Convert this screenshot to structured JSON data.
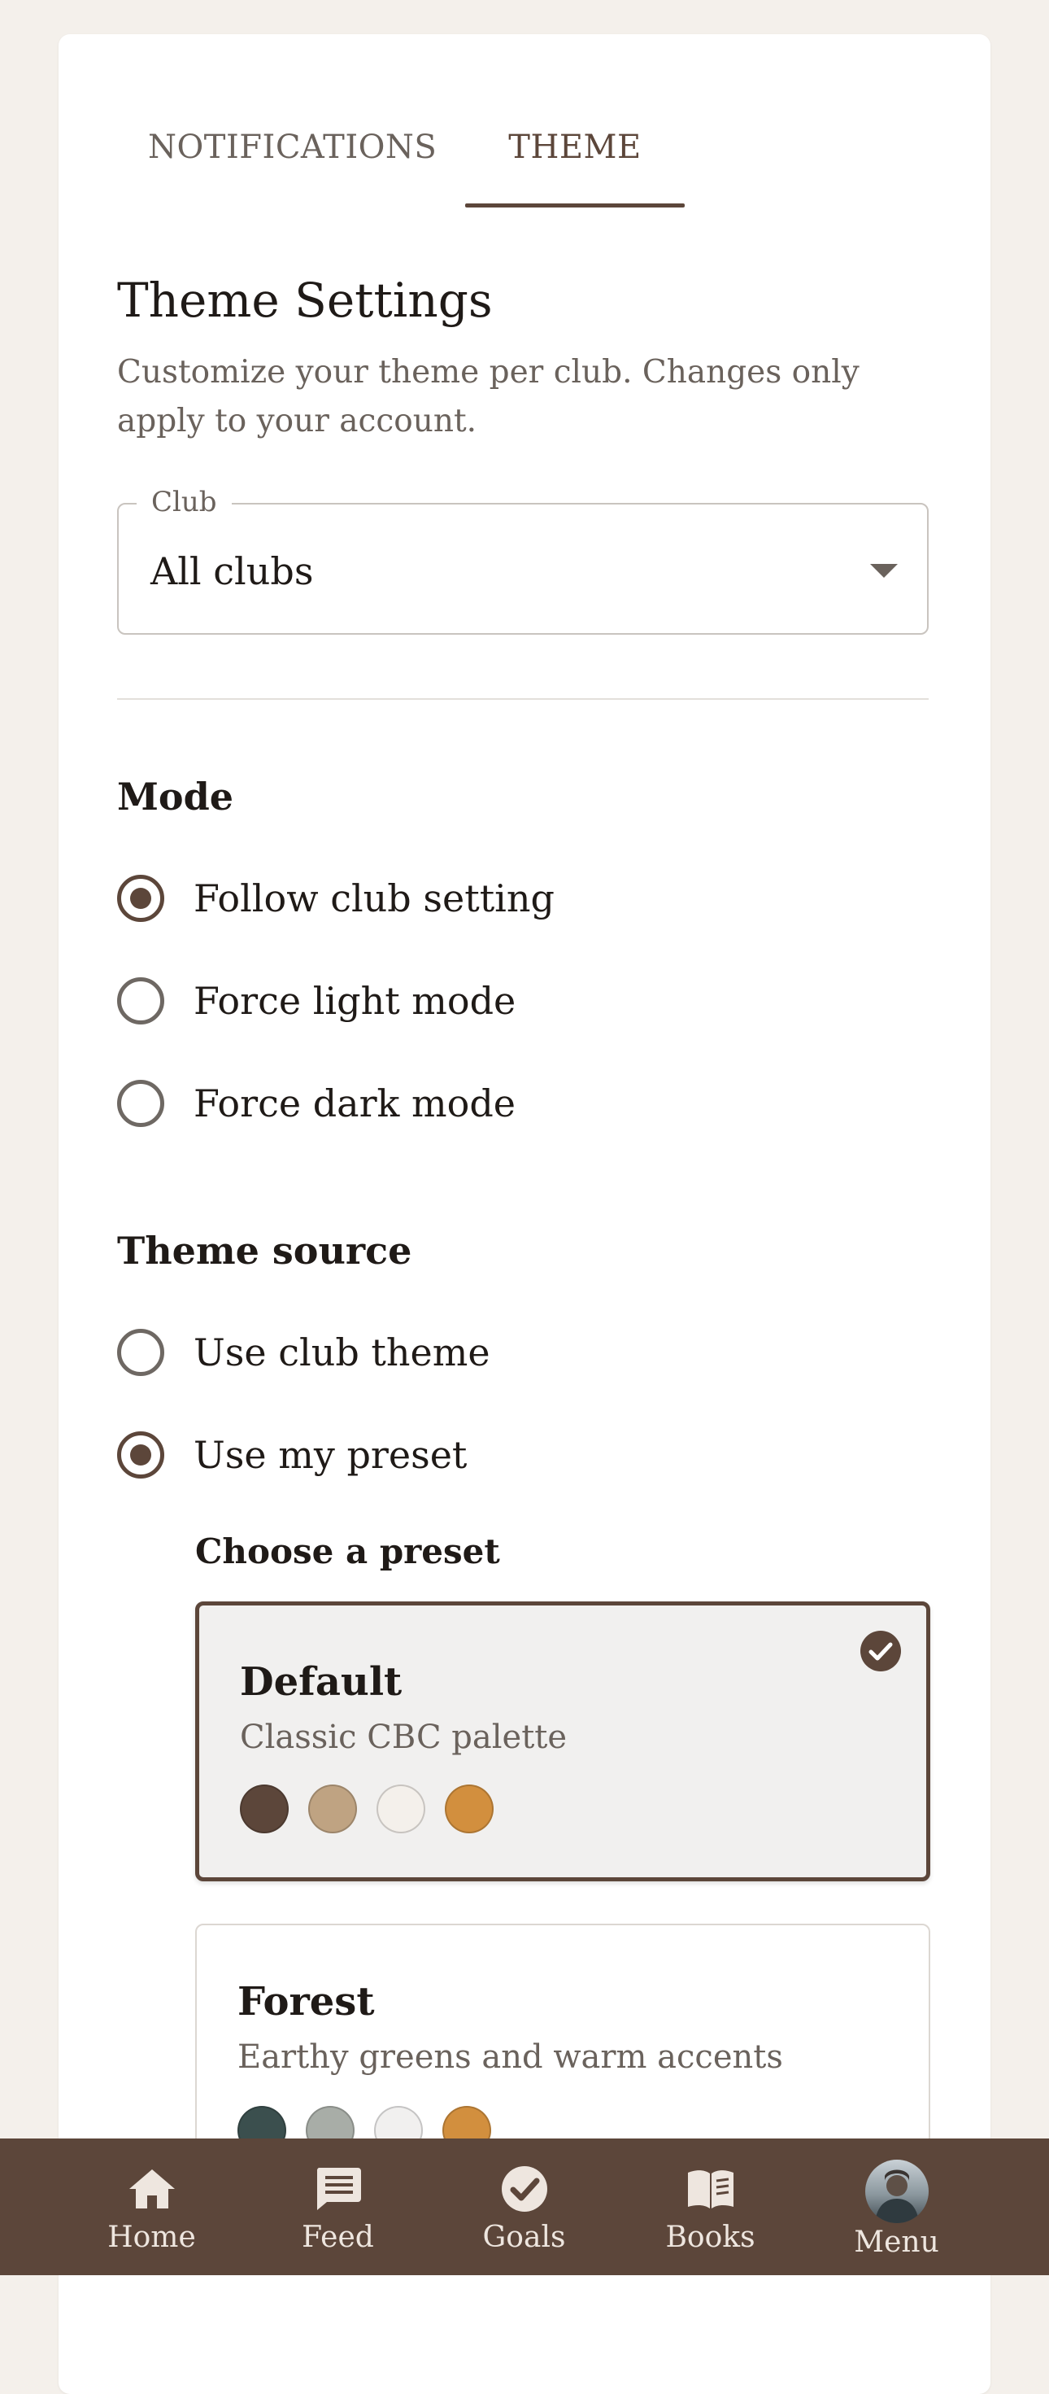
{
  "tabs": [
    {
      "label": "NOTIFICATIONS",
      "active": false
    },
    {
      "label": "THEME",
      "active": true
    }
  ],
  "theme_settings": {
    "title": "Theme Settings",
    "description": "Customize your theme per club. Changes only apply to your account."
  },
  "club_select": {
    "label": "Club",
    "value": "All clubs"
  },
  "mode": {
    "title": "Mode",
    "options": [
      {
        "label": "Follow club setting",
        "checked": true
      },
      {
        "label": "Force light mode",
        "checked": false
      },
      {
        "label": "Force dark mode",
        "checked": false
      }
    ]
  },
  "theme_source": {
    "title": "Theme source",
    "options": [
      {
        "label": "Use club theme",
        "checked": false
      },
      {
        "label": "Use my preset",
        "checked": true
      }
    ]
  },
  "presets": {
    "heading": "Choose a preset",
    "items": [
      {
        "name": "Default",
        "description": "Classic CBC palette",
        "selected": true,
        "swatches": [
          "#5c463a",
          "#bfa382",
          "#f4f0eb",
          "#d28f3e"
        ]
      },
      {
        "name": "Forest",
        "description": "Earthy greens and warm accents",
        "selected": false,
        "swatches": [
          "#3b4f4e",
          "#a8ada7",
          "#f1f0ef",
          "#d28f3e"
        ]
      }
    ]
  },
  "bottom_nav": [
    {
      "label": "Home",
      "icon": "home-icon"
    },
    {
      "label": "Feed",
      "icon": "feed-icon"
    },
    {
      "label": "Goals",
      "icon": "goals-check-icon"
    },
    {
      "label": "Books",
      "icon": "book-icon"
    },
    {
      "label": "Menu",
      "icon": "avatar"
    }
  ],
  "colors": {
    "primary": "#5c463a",
    "background": "#f4f0eb",
    "surface": "#ffffff"
  }
}
